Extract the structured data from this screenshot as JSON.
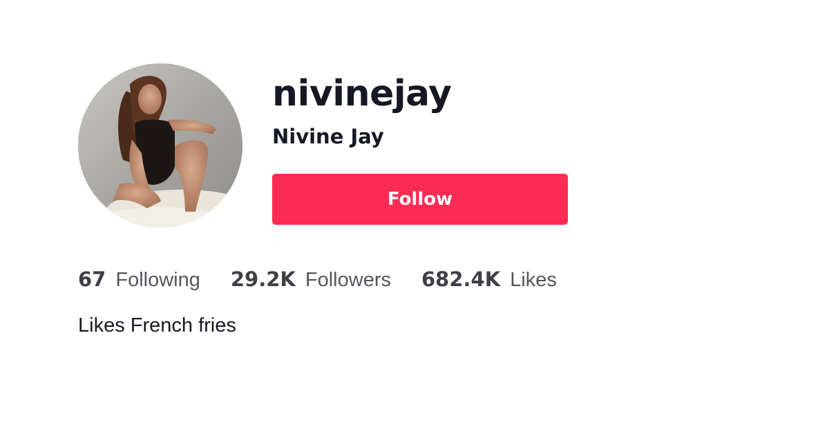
{
  "profile": {
    "username": "nivinejay",
    "display_name": "Nivine Jay",
    "follow_label": "Follow",
    "bio": "Likes French fries",
    "avatar_icon": "profile-photo"
  },
  "stats": [
    {
      "value": "67",
      "label": "Following"
    },
    {
      "value": "29.2K",
      "label": "Followers"
    },
    {
      "value": "682.4K",
      "label": "Likes"
    }
  ],
  "colors": {
    "accent": "#fe2c55",
    "text_primary": "#161823",
    "text_secondary": "#55565c"
  }
}
